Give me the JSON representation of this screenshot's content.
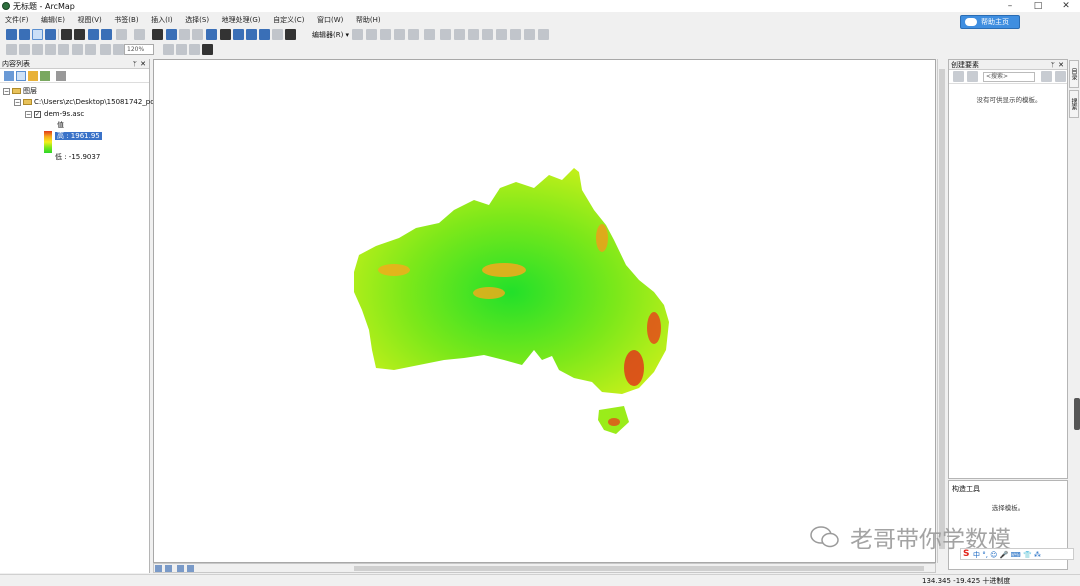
{
  "window": {
    "title": "无标题 - ArcMap",
    "minimize": "–",
    "maximize": "□",
    "close": "✕"
  },
  "menu": [
    "文件(F)",
    "编辑(E)",
    "视图(V)",
    "书签(B)",
    "插入(I)",
    "选择(S)",
    "地理处理(G)",
    "自定义(C)",
    "窗口(W)",
    "帮助(H)"
  ],
  "cloud_button": "帮助主页",
  "toolbar": {
    "zoom_value": "120%",
    "editor_label": "编辑器(R) ▾"
  },
  "toc": {
    "title": "内容列表",
    "pin": "ᛘ",
    "close": "✕",
    "layers_label": "图层",
    "path_label": "C:\\Users\\zc\\Desktop\\15081742_pc",
    "layer_name": "dem-9s.asc",
    "value_label": "值",
    "high_label": "高 : 1961.95",
    "low_label": "低 : -15.9037"
  },
  "create_features": {
    "title": "创建要素",
    "search_placeholder": "<搜索>",
    "empty_message": "没有可供显示的模板。"
  },
  "construct_tools": {
    "title": "构造工具",
    "message": "选择模板。"
  },
  "side_tabs": [
    "目录",
    "搜索"
  ],
  "status": {
    "coordinates": "134.345  -19.425 十进制度"
  },
  "watermark": "老哥带你学数模",
  "ime": {
    "logo": "S",
    "text": "中 °, ☺ 🎤 ⌨ 👕 ⁂"
  },
  "colors": {
    "ramp_high": "#e03a1a",
    "ramp_mid": "#f4ef1a",
    "ramp_low": "#2bd62b",
    "accent": "#3a72c8"
  }
}
